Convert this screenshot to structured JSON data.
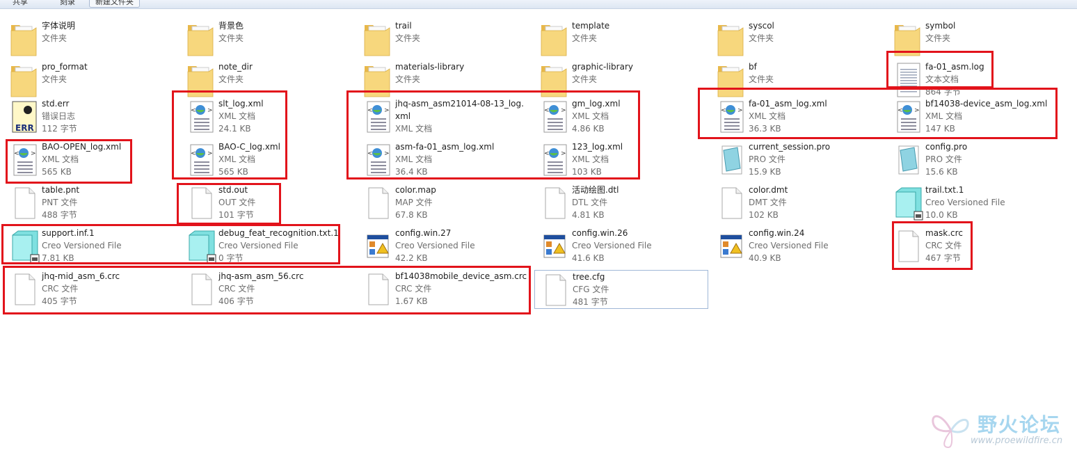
{
  "toolbar": {
    "buttons": [
      "共享",
      "刻录",
      "新建文件夹"
    ]
  },
  "files": [
    {
      "name": "字体说明",
      "type": "文件夹",
      "icon": "folder-icon"
    },
    {
      "name": "背景色",
      "type": "文件夹",
      "icon": "folder-icon"
    },
    {
      "name": "trail",
      "type": "文件夹",
      "icon": "folder-icon"
    },
    {
      "name": "template",
      "type": "文件夹",
      "icon": "folder-icon"
    },
    {
      "name": "syscol",
      "type": "文件夹",
      "icon": "folder-icon"
    },
    {
      "name": "symbol",
      "type": "文件夹",
      "icon": "folder-icon"
    },
    {
      "name": "pro_format",
      "type": "文件夹",
      "icon": "folder-icon"
    },
    {
      "name": "note_dir",
      "type": "文件夹",
      "icon": "folder-icon"
    },
    {
      "name": "materials-library",
      "type": "文件夹",
      "icon": "folder-icon"
    },
    {
      "name": "graphic-library",
      "type": "文件夹",
      "icon": "folder-icon"
    },
    {
      "name": "bf",
      "type": "文件夹",
      "icon": "folder-icon"
    },
    {
      "name": "fa-01_asm.log",
      "type": "文本文档",
      "size": "864 字节",
      "icon": "text-document-icon"
    },
    {
      "name": "std.err",
      "type": "错误日志",
      "size": "112 字节",
      "icon": "error-log-icon"
    },
    {
      "name": "slt_log.xml",
      "type": "XML 文档",
      "size": "24.1 KB",
      "icon": "xml-document-icon"
    },
    {
      "name": "jhq-asm_asm21014-08-13_log.xml",
      "type": "XML 文档",
      "icon": "xml-document-icon"
    },
    {
      "name": "gm_log.xml",
      "type": "XML 文档",
      "size": "4.86 KB",
      "icon": "xml-document-icon"
    },
    {
      "name": "fa-01_asm_log.xml",
      "type": "XML 文档",
      "size": "36.3 KB",
      "icon": "xml-document-icon"
    },
    {
      "name": "bf14038-device_asm_log.xml",
      "type": "XML 文档",
      "size": "147 KB",
      "icon": "xml-document-icon"
    },
    {
      "name": "BAO-OPEN_log.xml",
      "type": "XML 文档",
      "size": "565 KB",
      "icon": "xml-document-icon"
    },
    {
      "name": "BAO-C_log.xml",
      "type": "XML 文档",
      "size": "565 KB",
      "icon": "xml-document-icon"
    },
    {
      "name": "asm-fa-01_asm_log.xml",
      "type": "XML 文档",
      "size": "36.4 KB",
      "icon": "xml-document-icon"
    },
    {
      "name": "123_log.xml",
      "type": "XML 文档",
      "size": "103 KB",
      "icon": "xml-document-icon"
    },
    {
      "name": "current_session.pro",
      "type": "PRO 文件",
      "size": "15.9 KB",
      "icon": "pro-file-icon"
    },
    {
      "name": "config.pro",
      "type": "PRO 文件",
      "size": "15.6 KB",
      "icon": "pro-file-icon"
    },
    {
      "name": "table.pnt",
      "type": "PNT 文件",
      "size": "488 字节",
      "icon": "blank-file-icon"
    },
    {
      "name": "std.out",
      "type": "OUT 文件",
      "size": "101 字节",
      "icon": "blank-file-icon"
    },
    {
      "name": "color.map",
      "type": "MAP 文件",
      "size": "67.8 KB",
      "icon": "blank-file-icon"
    },
    {
      "name": "活动绘图.dtl",
      "type": "DTL 文件",
      "size": "4.81 KB",
      "icon": "blank-file-icon"
    },
    {
      "name": "color.dmt",
      "type": "DMT 文件",
      "size": "102 KB",
      "icon": "blank-file-icon"
    },
    {
      "name": "trail.txt.1",
      "type": "Creo Versioned File",
      "size": "10.0 KB",
      "icon": "creo-versioned-file-icon"
    },
    {
      "name": "support.inf.1",
      "type": "Creo Versioned File",
      "size": "7.81 KB",
      "icon": "creo-versioned-file-icon"
    },
    {
      "name": "debug_feat_recognition.txt.1",
      "type": "Creo Versioned File",
      "size": "0 字节",
      "icon": "creo-versioned-file-icon"
    },
    {
      "name": "config.win.27",
      "type": "Creo Versioned File",
      "size": "42.2 KB",
      "icon": "config-win-icon"
    },
    {
      "name": "config.win.26",
      "type": "Creo Versioned File",
      "size": "41.6 KB",
      "icon": "config-win-icon"
    },
    {
      "name": "config.win.24",
      "type": "Creo Versioned File",
      "size": "40.9 KB",
      "icon": "config-win-icon"
    },
    {
      "name": "mask.crc",
      "type": "CRC 文件",
      "size": "467 字节",
      "icon": "blank-file-icon"
    },
    {
      "name": "jhq-mid_asm_6.crc",
      "type": "CRC 文件",
      "size": "405 字节",
      "icon": "blank-file-icon"
    },
    {
      "name": "jhq-asm_asm_56.crc",
      "type": "CRC 文件",
      "size": "406 字节",
      "icon": "blank-file-icon"
    },
    {
      "name": "bf14038mobile_device_asm.crc",
      "type": "CRC 文件",
      "size": "1.67 KB",
      "icon": "blank-file-icon"
    },
    {
      "name": "tree.cfg",
      "type": "CFG 文件",
      "size": "481 字节",
      "icon": "blank-file-icon"
    }
  ],
  "watermark": {
    "title": "野火论坛",
    "url": "www.proewildfire.cn"
  },
  "colors": {
    "highlight": "#e2131b",
    "folder": "#f4cf6a",
    "selection_border": "#9fb7d7"
  }
}
